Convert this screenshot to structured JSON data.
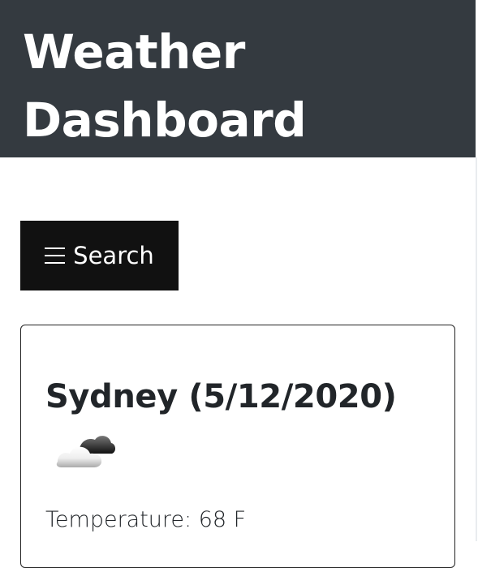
{
  "header": {
    "title": "Weather Dashboard"
  },
  "search_button": {
    "icon": "hamburger-menu-icon",
    "label": "Search"
  },
  "weather_card": {
    "title": "Sydney (5/12/2020)",
    "icon": "cloudy-weather-icon",
    "temperature": "Temperature: 68 F"
  },
  "colors": {
    "header_background": "#343a40",
    "button_background": "#111111",
    "text": "#212529",
    "border": "#222222"
  }
}
